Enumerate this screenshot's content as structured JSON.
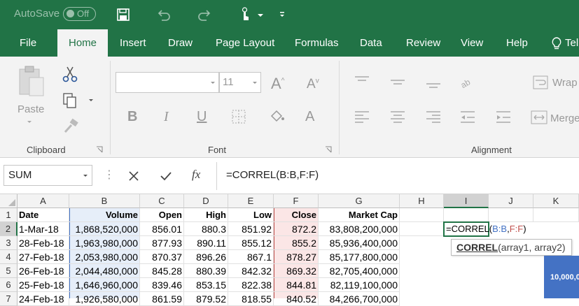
{
  "titlebar": {
    "autosave_label": "AutoSave",
    "autosave_state": "Off"
  },
  "tabs": [
    "File",
    "Home",
    "Insert",
    "Draw",
    "Page Layout",
    "Formulas",
    "Data",
    "Review",
    "View",
    "Help",
    "Tel"
  ],
  "ribbon": {
    "paste_label": "Paste",
    "font_name": "",
    "font_size": "11",
    "wrap_label": "Wrap",
    "merge_label": "Merge",
    "groups": {
      "clipboard": "Clipboard",
      "font": "Font",
      "alignment": "Alignment"
    }
  },
  "formula_bar": {
    "name_box": "SUM",
    "formula": "=CORREL(B:B,F:F)",
    "fx": "fx"
  },
  "columns": [
    "A",
    "B",
    "C",
    "D",
    "E",
    "F",
    "G",
    "H",
    "I",
    "J",
    "K"
  ],
  "rows": [
    "1",
    "2",
    "3",
    "4",
    "5",
    "6",
    "7"
  ],
  "headers": [
    "Date",
    "Volume",
    "Open",
    "High",
    "Low",
    "Close",
    "Market Cap"
  ],
  "data": [
    [
      "1-Mar-18",
      "1,868,520,000",
      "856.01",
      "880.3",
      "851.92",
      "872.2",
      "83,808,200,000"
    ],
    [
      "28-Feb-18",
      "1,963,980,000",
      "877.93",
      "890.11",
      "855.12",
      "855.2",
      "85,936,400,000"
    ],
    [
      "27-Feb-18",
      "2,053,980,000",
      "870.37",
      "896.26",
      "867.1",
      "878.27",
      "85,177,800,000"
    ],
    [
      "26-Feb-18",
      "2,044,480,000",
      "845.28",
      "880.39",
      "842.32",
      "869.32",
      "82,705,400,000"
    ],
    [
      "25-Feb-18",
      "1,646,960,000",
      "839.46",
      "853.15",
      "822.38",
      "844.81",
      "82,119,100,000"
    ],
    [
      "24-Feb-18",
      "1,926,580,000",
      "861.59",
      "879.52",
      "818.55",
      "840.52",
      "84,266,700,000"
    ]
  ],
  "active_cell_formula": {
    "prefix": "=CORREL(",
    "arg1": "B:B",
    "comma": ",",
    "arg2": "F:F",
    "suffix": ")"
  },
  "tooltip": {
    "func": "CORREL",
    "args": "(array1, array2)"
  },
  "chart_label": "10,000,0",
  "colors": {
    "accent": "#217346",
    "ref_blue": "#4472c4",
    "ref_red": "#c0504d"
  }
}
